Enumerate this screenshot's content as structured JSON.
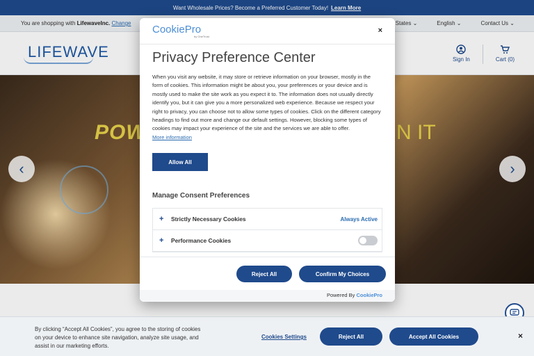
{
  "promo": {
    "text": "Want Wholesale Prices? Become a Preferred Customer Today!",
    "link": "Learn More"
  },
  "shopbar": {
    "prefix": "You are shopping with",
    "company": "LifewaveInc.",
    "change": "Change",
    "links": [
      "States",
      "English",
      "Contact Us"
    ]
  },
  "header": {
    "logo": "LIFEWAVE",
    "signin": "Sign In",
    "cart": "Cart (0)"
  },
  "hero": {
    "text_left": "POW",
    "text_right": "N IT"
  },
  "modal": {
    "brand": "CookiePro",
    "brand_sub": "by OneTrust",
    "close": "×",
    "title": "Privacy Preference Center",
    "description": "When you visit any website, it may store or retrieve information on your browser, mostly in the form of cookies. This information might be about you, your preferences or your device and is mostly used to make the site work as you expect it to. The information does not usually directly identify you, but it can give you a more personalized web experience. Because we respect your right to privacy, you can choose not to allow some types of cookies. Click on the different category headings to find out more and change our default settings. However, blocking some types of cookies may impact your experience of the site and the services we are able to offer.",
    "more_info": "More information",
    "allow_all": "Allow All",
    "manage_title": "Manage Consent Preferences",
    "categories": [
      {
        "name": "Strictly Necessary Cookies",
        "status": "Always Active"
      },
      {
        "name": "Performance Cookies",
        "status": ""
      }
    ],
    "reject_all": "Reject All",
    "confirm": "Confirm My Choices",
    "powered_by": "Powered By",
    "powered_brand": "CookiePro"
  },
  "banner": {
    "text": "By clicking “Accept All Cookies”, you agree to the storing of cookies on your device to enhance site navigation, analyze site usage, and assist in our marketing efforts.",
    "settings": "Cookies Settings",
    "reject": "Reject All",
    "accept": "Accept All Cookies",
    "close": "×"
  },
  "colors": {
    "primary": "#1f4a8c",
    "brand": "#4d8fd6",
    "accent_yellow": "#e8d34a"
  }
}
